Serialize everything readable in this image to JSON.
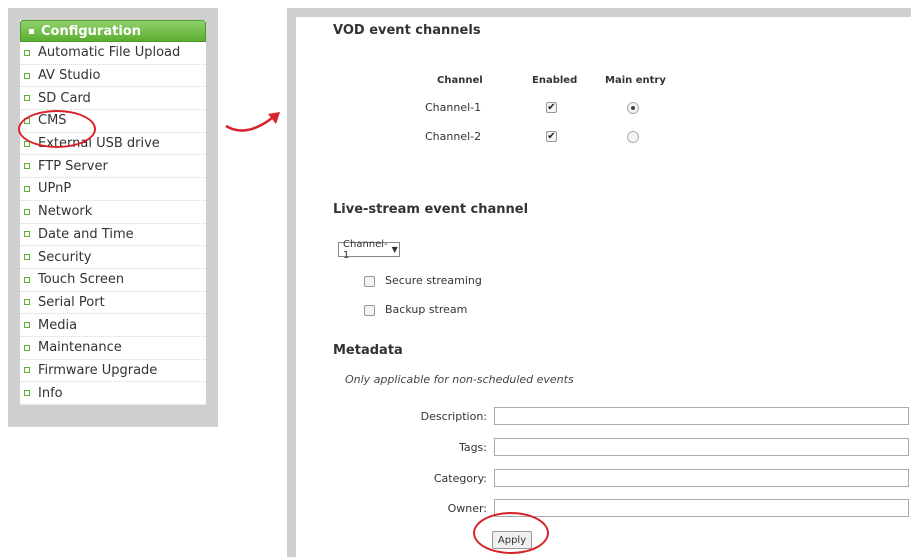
{
  "menu": {
    "header": "Configuration",
    "items": [
      "Automatic File Upload",
      "AV Studio",
      "SD Card",
      "CMS",
      "External USB drive",
      "FTP Server",
      "UPnP",
      "Network",
      "Date and Time",
      "Security",
      "Touch Screen",
      "Serial Port",
      "Media",
      "Maintenance",
      "Firmware Upgrade",
      "Info"
    ]
  },
  "vod": {
    "title": "VOD event channels",
    "col_channel": "Channel",
    "col_enabled": "Enabled",
    "col_main": "Main entry",
    "rows": [
      {
        "name": "Channel-1",
        "enabled": true,
        "main": true
      },
      {
        "name": "Channel-2",
        "enabled": true,
        "main": false
      }
    ]
  },
  "live": {
    "title": "Live-stream event channel",
    "selected_channel": "Channel-1",
    "dropdown_arrow": "▼",
    "secure_label": "Secure streaming",
    "backup_label": "Backup stream"
  },
  "metadata": {
    "title": "Metadata",
    "note": "Only applicable for non-scheduled events",
    "description_label": "Description:",
    "tags_label": "Tags:",
    "category_label": "Category:",
    "owner_label": "Owner:",
    "apply_label": "Apply"
  },
  "icons": {
    "checkmark": "✔"
  },
  "colors": {
    "accent_green": "#5cae31",
    "callout_red": "#d8232a"
  }
}
